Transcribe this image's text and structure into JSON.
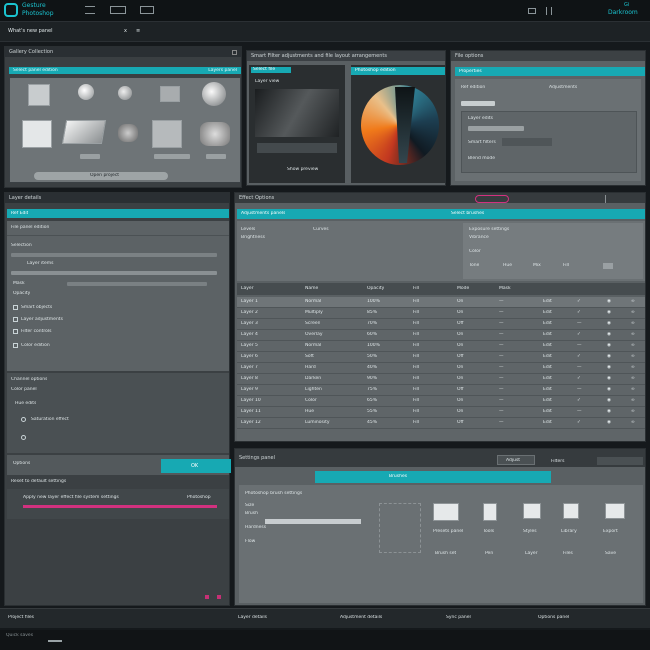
{
  "app": {
    "title": "Gesture",
    "subtitle": "Photoshop"
  },
  "topbar": {
    "right_title": "Darkroom",
    "right_sub": "Gi"
  },
  "menubar": {
    "label": "What's new panel",
    "icons": [
      "x",
      "≡"
    ]
  },
  "left_top_panel": {
    "header": "Gallery Collection",
    "teal_bar_left": "Select panel edition",
    "teal_bar_right": "Layers panel",
    "button": "Open project"
  },
  "mid_top_panel": {
    "header": "Smart Filter adjustments and file layout arrangements",
    "teal_label": "Select file",
    "sub_label": "Layer view",
    "button": "Show preview"
  },
  "color_panel": {
    "teal_label": "Photoshop edition"
  },
  "right_top_panel": {
    "header": "File options",
    "teal_label": "Properties",
    "col1": "Ref edition",
    "col2": "Adjustments",
    "row_a": "Layer edits",
    "row_b": "Smart filters",
    "row_c": "Blend mode"
  },
  "left_lower_panel": {
    "header": "Layer details",
    "teal_tab": "Ref Edit",
    "row1": "File panel edition",
    "field1": "Selection",
    "field2": "Layer items",
    "field3": "Mask",
    "field4": "Opacity",
    "check1": "Smart objects",
    "check2": "Layer adjustments",
    "check3": "Filter controls",
    "check4": "Color edition",
    "section": "Channel options",
    "ch_a": "Color panel",
    "ch_b": "Hue edits",
    "ch_c": "Saturation effect",
    "footer": "Options",
    "footer_btn": "OK",
    "footer_line": "Reset to default settings",
    "pink_label": "Apply new layer effect file system settings",
    "pink_right": "Photoshop",
    "status": "Status panel"
  },
  "main_panel": {
    "header": "Effect Options",
    "teal_left": "Adjustments panels",
    "teal_right": "Select brushes",
    "sub_a": "Levels",
    "sub_b": "Curves",
    "sub_c": "Brightness",
    "right_a": "Exposure settings",
    "right_b": "Vibrance",
    "right_c": "Color",
    "mini_buttons": [
      "Tone",
      "Hue",
      "Mix",
      "Fill"
    ],
    "table_headers": [
      "Layer",
      "Name",
      "Opacity",
      "Fill",
      "Mode",
      "Mask",
      "Edit",
      "Lock",
      "View",
      "Link"
    ],
    "table_rows": [
      [
        "Layer 1",
        "Normal",
        "100%",
        "Fill",
        "On",
        "—",
        "Edit",
        "✓",
        "◉",
        "∞"
      ],
      [
        "Layer 2",
        "Multiply",
        "85%",
        "Fill",
        "On",
        "—",
        "Edit",
        "✓",
        "◉",
        "∞"
      ],
      [
        "Layer 3",
        "Screen",
        "70%",
        "Fill",
        "Off",
        "—",
        "Edit",
        "—",
        "◉",
        "∞"
      ],
      [
        "Layer 4",
        "Overlay",
        "60%",
        "Fill",
        "On",
        "—",
        "Edit",
        "✓",
        "◉",
        "∞"
      ],
      [
        "Layer 5",
        "Normal",
        "100%",
        "Fill",
        "On",
        "—",
        "Edit",
        "—",
        "◉",
        "∞"
      ],
      [
        "Layer 6",
        "Soft",
        "50%",
        "Fill",
        "Off",
        "—",
        "Edit",
        "✓",
        "◉",
        "∞"
      ],
      [
        "Layer 7",
        "Hard",
        "40%",
        "Fill",
        "On",
        "—",
        "Edit",
        "—",
        "◉",
        "∞"
      ],
      [
        "Layer 8",
        "Darken",
        "90%",
        "Fill",
        "On",
        "—",
        "Edit",
        "✓",
        "◉",
        "∞"
      ],
      [
        "Layer 9",
        "Lighten",
        "75%",
        "Fill",
        "Off",
        "—",
        "Edit",
        "—",
        "◉",
        "∞"
      ],
      [
        "Layer 10",
        "Color",
        "65%",
        "Fill",
        "On",
        "—",
        "Edit",
        "✓",
        "◉",
        "∞"
      ],
      [
        "Layer 11",
        "Hue",
        "55%",
        "Fill",
        "On",
        "—",
        "Edit",
        "—",
        "◉",
        "∞"
      ],
      [
        "Layer 12",
        "Luminosity",
        "45%",
        "Fill",
        "Off",
        "—",
        "Edit",
        "✓",
        "◉",
        "∞"
      ]
    ]
  },
  "bottom_panel": {
    "header": "Settings panel",
    "tab_btn": "Adjust",
    "tab_right": "Filters",
    "teal_tab": "Brushes",
    "section": "Photoshop brush settings",
    "field1": "Size",
    "field2": "Brush",
    "field3": "Hardness",
    "field4": "Flow",
    "icons": [
      {
        "label": "Presets panel",
        "sub": "Brush set"
      },
      {
        "label": "Tools",
        "sub": "Pen"
      },
      {
        "label": "Styles",
        "sub": "Layer"
      },
      {
        "label": "Library",
        "sub": "Files"
      },
      {
        "label": "Export",
        "sub": "Save"
      }
    ]
  },
  "statusbar": {
    "left": "Project files",
    "mid1": "Layer details",
    "mid2": "Adjustment details",
    "mid3": "Sync panel",
    "right": "Options panel",
    "bottom": "Quick saves"
  },
  "colors": {
    "accent": "#17a9b3",
    "pink": "#d2317f",
    "bg": "#15191c"
  }
}
